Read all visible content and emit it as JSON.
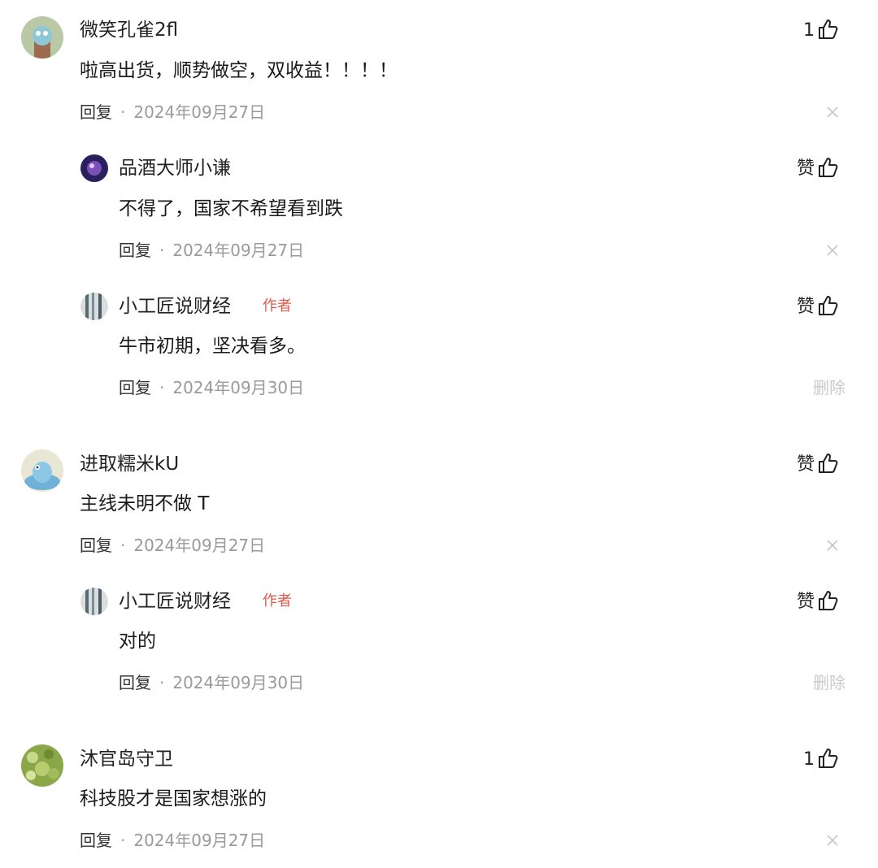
{
  "comments": [
    {
      "name": "微笑孔雀2fl",
      "content": "啦高出货，顺势做空，双收益！！！！",
      "reply": "回复",
      "sep": "·",
      "date": "2024年09月27日",
      "like": "1"
    },
    {
      "name": "品酒大师小谦",
      "content": "不得了，国家不希望看到跌",
      "reply": "回复",
      "sep": "·",
      "date": "2024年09月27日",
      "like": "赞"
    },
    {
      "name": "小工匠说财经",
      "tag": "作者",
      "content": "牛市初期，坚决看多。",
      "reply": "回复",
      "sep": "·",
      "date": "2024年09月30日",
      "like": "赞",
      "delete": "删除"
    },
    {
      "name": "进取糯米kU",
      "content": "主线未明不做 T",
      "reply": "回复",
      "sep": "·",
      "date": "2024年09月27日",
      "like": "赞"
    },
    {
      "name": "小工匠说财经",
      "tag": "作者",
      "content": "对的",
      "reply": "回复",
      "sep": "·",
      "date": "2024年09月30日",
      "like": "赞",
      "delete": "删除"
    },
    {
      "name": "沐官岛守卫",
      "content": "科技股才是国家想涨的",
      "reply": "回复",
      "sep": "·",
      "date": "2024年09月27日",
      "like": "1"
    }
  ],
  "colors": {
    "author_tag": "#e05a4b",
    "date": "#9a9a9a",
    "delete": "#c9c9c9"
  }
}
